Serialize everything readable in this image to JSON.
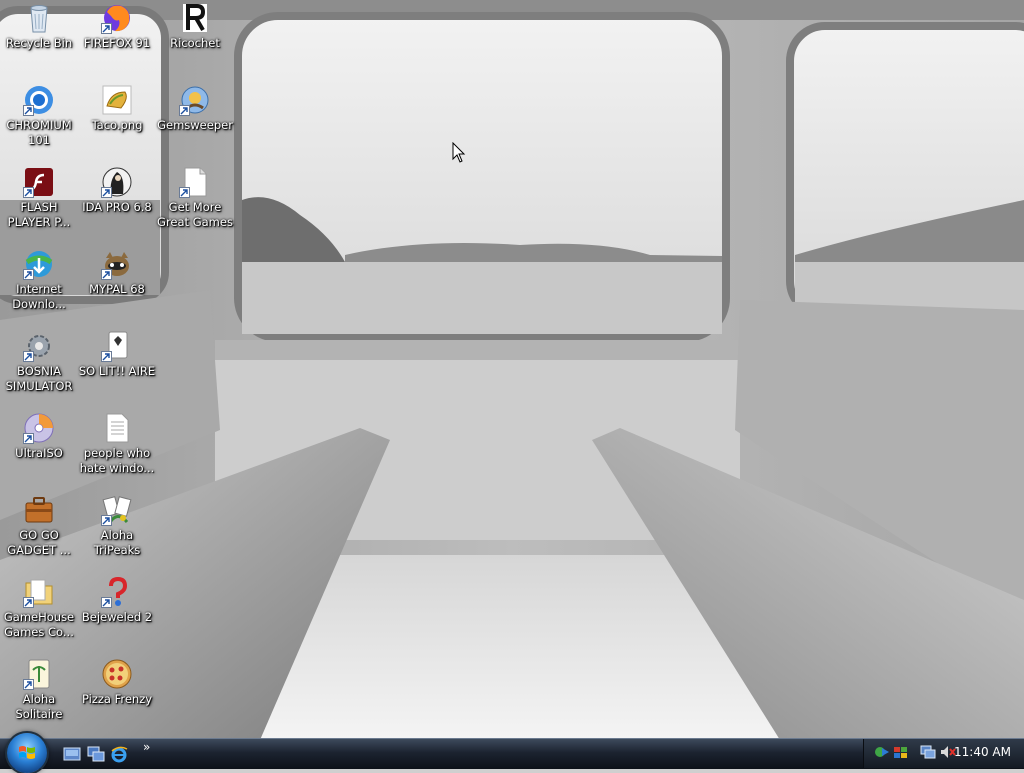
{
  "desktop": {
    "icons": [
      {
        "label": "Recycle Bin",
        "icon": "recycle-bin-icon"
      },
      {
        "label": "FIREFOX 91",
        "icon": "firefox-icon"
      },
      {
        "label": "Ricochet",
        "icon": "ricochet-icon"
      },
      {
        "label": "CHROMIUM 101",
        "icon": "chromium-icon"
      },
      {
        "label": "Taco.png",
        "icon": "taco-image-icon"
      },
      {
        "label": "Gemsweeper",
        "icon": "gemsweeper-icon"
      },
      {
        "label": "FLASH PLAYER P...",
        "icon": "flash-player-icon"
      },
      {
        "label": "IDA PRO 6.8",
        "icon": "ida-pro-icon"
      },
      {
        "label": "Get More Great Games",
        "icon": "document-icon"
      },
      {
        "label": "Internet Downlo...",
        "icon": "internet-download-manager-icon"
      },
      {
        "label": "MYPAL 68",
        "icon": "mypal-icon"
      },
      {
        "label": "BOSNIA SIMULATOR",
        "icon": "gear-icon"
      },
      {
        "label": "SO LIT!! AIRE",
        "icon": "solitaire-card-icon"
      },
      {
        "label": "UltraISO",
        "icon": "ultraiso-icon"
      },
      {
        "label": "people who hate windo...",
        "icon": "text-document-icon"
      },
      {
        "label": "GO GO GADGET ...",
        "icon": "briefcase-icon"
      },
      {
        "label": "Aloha TriPeaks",
        "icon": "tripeaks-icon"
      },
      {
        "label": "GameHouse Games Co...",
        "icon": "folder-icon"
      },
      {
        "label": "Bejeweled 2",
        "icon": "bejeweled-icon"
      },
      {
        "label": "Aloha Solitaire",
        "icon": "aloha-solitaire-icon"
      },
      {
        "label": "Pizza Frenzy",
        "icon": "pizza-icon"
      }
    ]
  },
  "taskbar": {
    "start_button": "start-orb-icon",
    "quick_launch": [
      "show-desktop-icon",
      "switch-windows-icon",
      "internet-explorer-icon"
    ],
    "overflow": "»",
    "tray_icons": [
      "network-sharing-icon",
      "security-shield-icon",
      "network-connection-icon",
      "volume-muted-icon"
    ],
    "clock": "11:40 AM"
  },
  "colors": {
    "taskbar": "#1c2330",
    "label_text": "#ffffff",
    "start_orb": "#2a7fd4"
  }
}
